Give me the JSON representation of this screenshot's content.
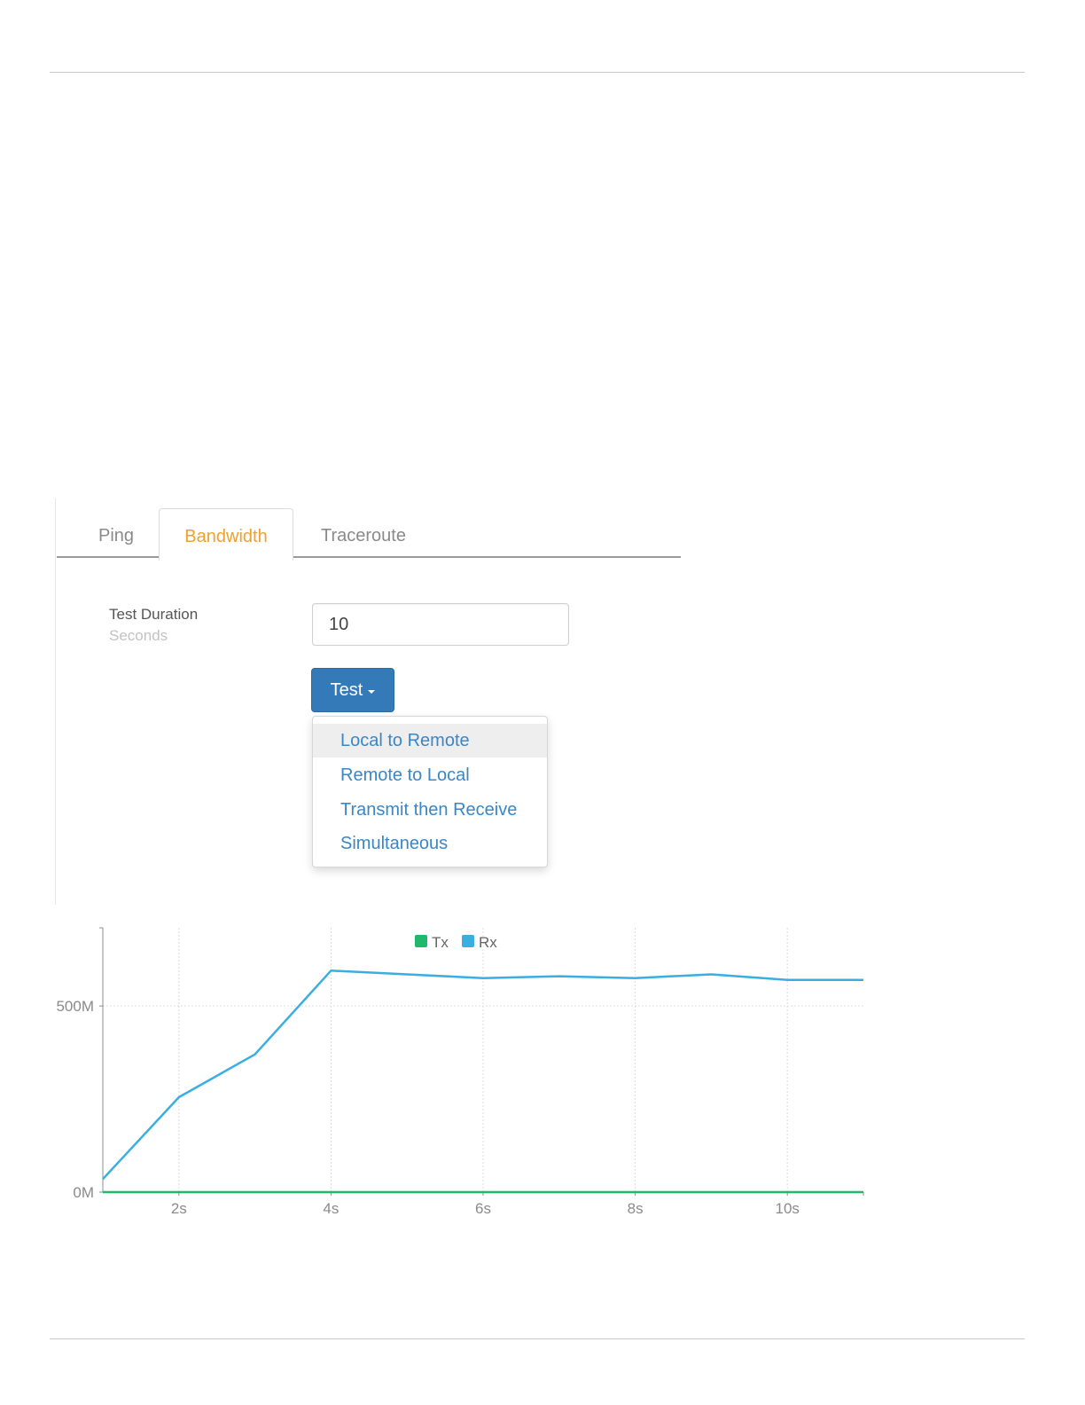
{
  "tabs": {
    "ping": "Ping",
    "bandwidth": "Bandwidth",
    "traceroute": "Traceroute",
    "active": "Bandwidth"
  },
  "form": {
    "duration_label": "Test Duration",
    "duration_unit": "Seconds",
    "duration_value": "10"
  },
  "test_button": {
    "label": "Test"
  },
  "dropdown": {
    "items": [
      "Local to Remote",
      "Remote to Local",
      "Transmit then Receive",
      "Simultaneous"
    ],
    "highlighted": "Local to Remote"
  },
  "colors": {
    "accent_tab": "#f0a030",
    "button": "#357ab8",
    "link": "#3a86c7",
    "tx": "#20b86a",
    "rx": "#3aaee0"
  },
  "chart_data": {
    "type": "line",
    "x_tick_labels": [
      "2s",
      "4s",
      "6s",
      "8s",
      "10s"
    ],
    "x_ticks": [
      2,
      4,
      6,
      8,
      10
    ],
    "xlim": [
      1,
      11
    ],
    "y_tick_labels": [
      "0M",
      "500M"
    ],
    "y_ticks": [
      0,
      500
    ],
    "ylim": [
      0,
      710
    ],
    "grid": true,
    "legend_placement": "top-center",
    "series": [
      {
        "name": "Tx",
        "color": "#20b86a",
        "x": [
          1,
          2,
          3,
          4,
          5,
          6,
          7,
          8,
          9,
          10,
          11
        ],
        "values": [
          0,
          0,
          0,
          0,
          0,
          0,
          0,
          0,
          0,
          0,
          0
        ]
      },
      {
        "name": "Rx",
        "color": "#3aaee0",
        "x": [
          1,
          2,
          3,
          4,
          5,
          6,
          7,
          8,
          9,
          10,
          11
        ],
        "values": [
          35,
          255,
          370,
          595,
          585,
          575,
          580,
          575,
          585,
          570,
          570
        ]
      }
    ]
  }
}
